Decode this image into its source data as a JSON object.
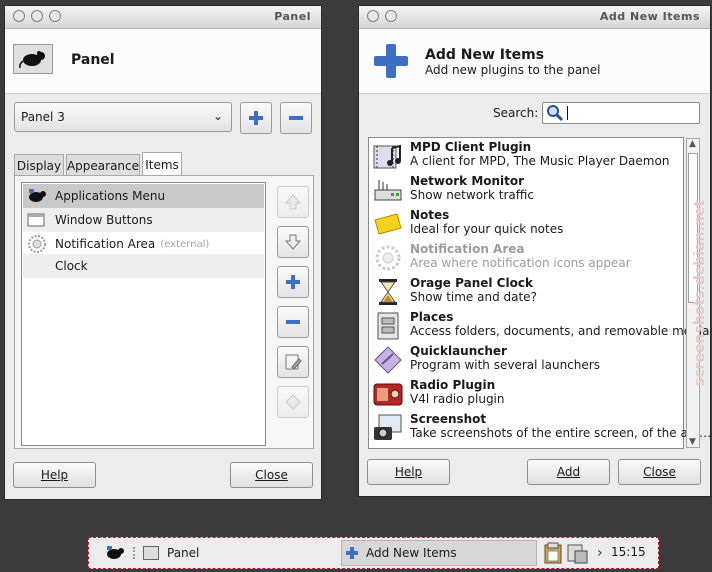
{
  "panel_prefs": {
    "title": "Panel",
    "header_title": "Panel",
    "selected_panel": "Panel 3",
    "tabs": [
      {
        "label": "Display"
      },
      {
        "label": "Appearance"
      },
      {
        "label": "Items"
      }
    ],
    "items": [
      {
        "label": "Applications Menu",
        "note": ""
      },
      {
        "label": "Window Buttons",
        "note": ""
      },
      {
        "label": "Notification Area",
        "note": "(external)"
      },
      {
        "label": "Clock",
        "note": ""
      }
    ],
    "help_label": "Help",
    "close_label": "Close"
  },
  "add_items": {
    "title": "Add New Items",
    "header_title": "Add New Items",
    "header_subtitle": "Add new plugins to the panel",
    "search_label": "Search:",
    "search_value": "",
    "plugins": [
      {
        "name": "MPD Client Plugin",
        "desc": "A client for MPD, The Music Player Daemon",
        "enabled": true
      },
      {
        "name": "Network Monitor",
        "desc": "Show network traffic",
        "enabled": true
      },
      {
        "name": "Notes",
        "desc": "Ideal for your quick notes",
        "enabled": true
      },
      {
        "name": "Notification Area",
        "desc": "Area where notification icons appear",
        "enabled": false
      },
      {
        "name": "Orage Panel Clock",
        "desc": "Show time and date?",
        "enabled": true
      },
      {
        "name": "Places",
        "desc": "Access folders, documents, and removable media",
        "enabled": true
      },
      {
        "name": "Quicklauncher",
        "desc": "Program with several launchers",
        "enabled": true
      },
      {
        "name": "Radio Plugin",
        "desc": "V4l radio plugin",
        "enabled": true
      },
      {
        "name": "Screenshot",
        "desc": "Take screenshots of the entire screen, of the act…",
        "enabled": true
      }
    ],
    "help_label": "Help",
    "add_label": "Add",
    "close_label": "Close"
  },
  "taskbar": {
    "tasks": [
      {
        "label": "Panel"
      },
      {
        "label": "Add New Items"
      }
    ],
    "clock": "15:15",
    "arrow": "›"
  },
  "watermark": "screenshots.debian.net",
  "colors": {
    "accent_blue": "#3d6fc4",
    "panel_dash": "#c0142c"
  }
}
